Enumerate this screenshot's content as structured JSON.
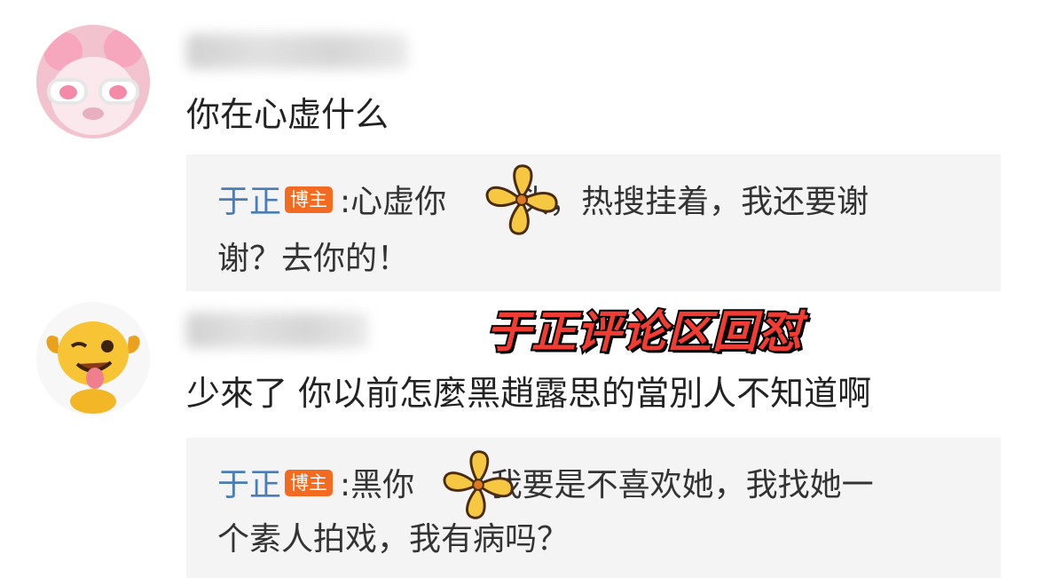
{
  "comments": [
    {
      "text": "你在心虚什么",
      "reply": {
        "author": "于正",
        "badge": "博主",
        "line1": ":心虚你",
        "line1_after": "头，热搜挂着，我还要谢",
        "line2": "谢？去你的！"
      }
    },
    {
      "text": "少來了 你以前怎麼黑趙露思的當別人不知道啊",
      "reply": {
        "author": "于正",
        "badge": "博主",
        "line1": ":黑你",
        "line1_after": " 我要是不喜欢她，我找她一",
        "line2": "个素人拍戏，我有病吗？"
      }
    }
  ],
  "overlay_title": "于正评论区回怼",
  "colors": {
    "author_blue": "#4a7db6",
    "badge_orange": "#f26b21",
    "reply_bg": "#f4f4f4",
    "overlay_red": "#f03c32"
  },
  "icons": [
    "avatar-pink-bear-icon",
    "avatar-yellow-dog-icon",
    "flower-sticker-icon"
  ]
}
